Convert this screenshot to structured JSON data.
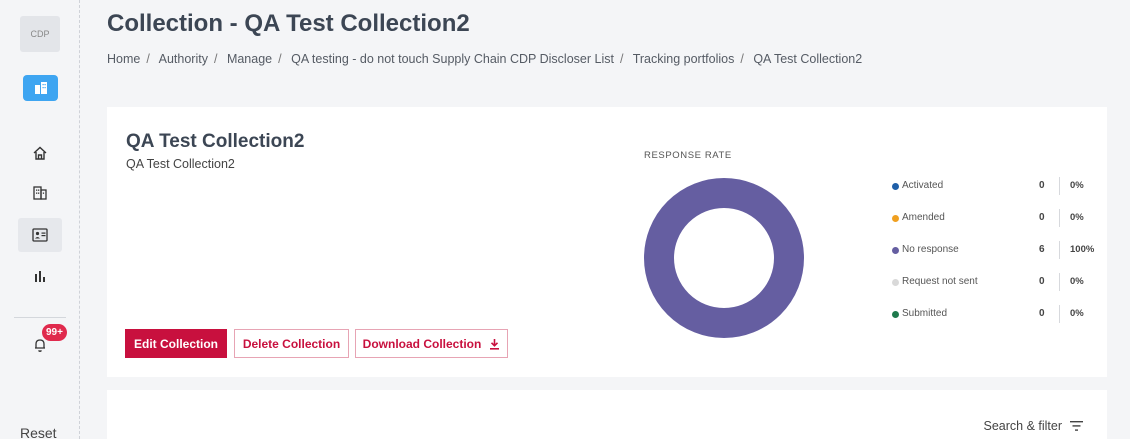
{
  "sidebar": {
    "logo_text": "CDP",
    "badge_count": "99+",
    "reset_label": "Reset",
    "icons": [
      "building-icon",
      "home-icon",
      "company-icon",
      "contact-card-icon",
      "bar-chart-icon",
      "bell-icon"
    ]
  },
  "header": {
    "title": "Collection - QA Test Collection2",
    "breadcrumb": [
      "Home",
      "Authority",
      "Manage",
      "QA testing - do not touch Supply Chain CDP Discloser List",
      "Tracking portfolios",
      "QA Test Collection2"
    ]
  },
  "card": {
    "title": "QA Test Collection2",
    "subtitle": "QA Test Collection2",
    "buttons": {
      "edit": "Edit Collection",
      "delete": "Delete Collection",
      "download": "Download Collection"
    }
  },
  "response_rate": {
    "label": "RESPONSE RATE",
    "items": [
      {
        "label": "Activated",
        "count": "0",
        "percent": "0%",
        "color": "#1f5fa8"
      },
      {
        "label": "Amended",
        "count": "0",
        "percent": "0%",
        "color": "#f0a020"
      },
      {
        "label": "No response",
        "count": "6",
        "percent": "100%",
        "color": "#655ea1"
      },
      {
        "label": "Request not sent",
        "count": "0",
        "percent": "0%",
        "color": "#d9d9d9"
      },
      {
        "label": "Submitted",
        "count": "0",
        "percent": "0%",
        "color": "#1f7a4d"
      }
    ],
    "donut_color": "#655ea1"
  },
  "list": {
    "search_filter_label": "Search & filter"
  },
  "colors": {
    "primary": "#c8103e",
    "accent": "#3ea5f1",
    "badge": "#e02a4d"
  }
}
